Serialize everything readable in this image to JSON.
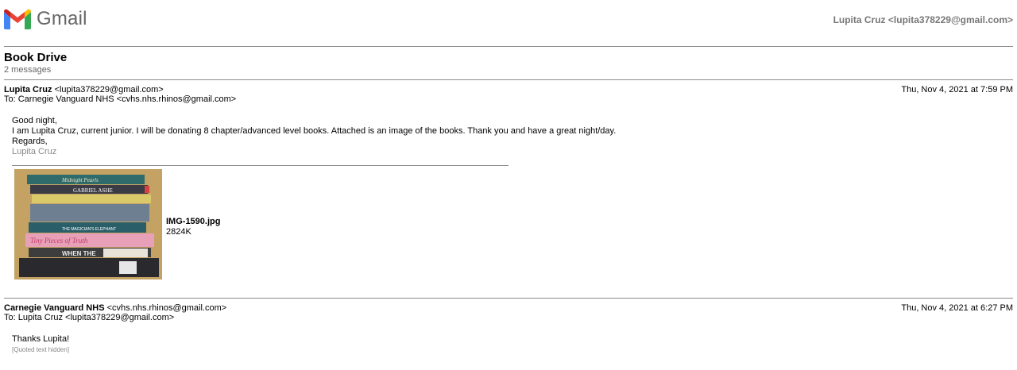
{
  "header": {
    "brand": "Gmail",
    "account": "Lupita Cruz <lupita378229@gmail.com>",
    "colors": {
      "red": "#EA4335",
      "blue": "#4285F4",
      "green": "#34A853",
      "yellow": "#FBBC04"
    }
  },
  "thread": {
    "subject": "Book Drive",
    "count": "2 messages"
  },
  "messages": [
    {
      "sender_name": "Lupita Cruz",
      "sender_email": "<lupita378229@gmail.com>",
      "to": "To: Carnegie Vanguard NHS <cvhs.nhs.rhinos@gmail.com>",
      "date": "Thu, Nov 4, 2021 at 7:59 PM",
      "body": [
        "Good night,",
        "I am Lupita Cruz, current junior. I will be donating 8 chapter/advanced level books. Attached is an image of the books. Thank you and have a great night/day.",
        "Regards,"
      ],
      "signature": "Lupita Cruz",
      "attachment": {
        "filename": "IMG-1590.jpg",
        "size": "2824K",
        "spines": [
          "Midnight Pearls",
          "GABRIEL ASHE",
          "THE MAGICIAN'S ELEPHANT",
          "Tiny Pieces of Truth",
          "WHEN THE"
        ]
      }
    },
    {
      "sender_name": "Carnegie Vanguard NHS",
      "sender_email": "<cvhs.nhs.rhinos@gmail.com>",
      "to": "To: Lupita Cruz <lupita378229@gmail.com>",
      "date": "Thu, Nov 4, 2021 at 6:27 PM",
      "body": [
        "Thanks Lupita!"
      ],
      "quoted": "[Quoted text hidden]"
    }
  ]
}
